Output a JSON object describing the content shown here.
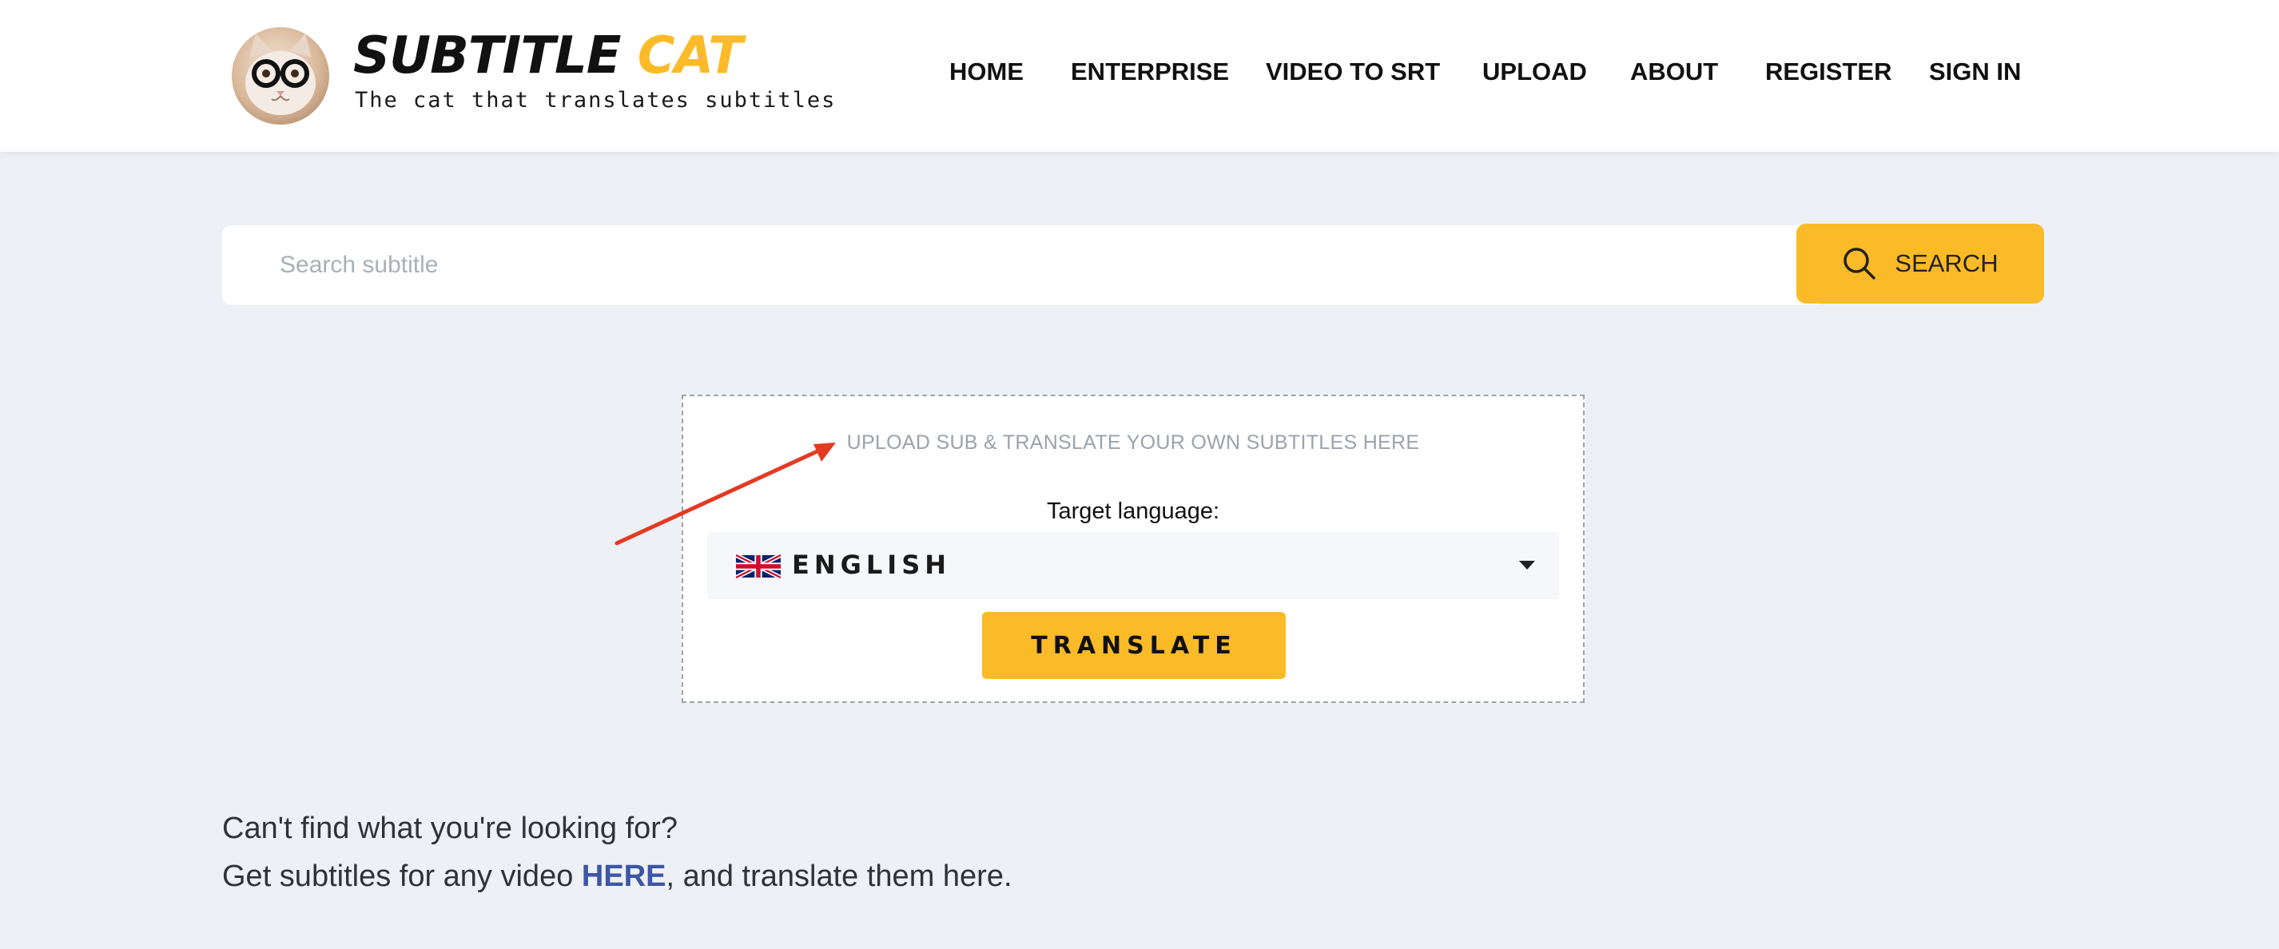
{
  "header": {
    "logo_title_part1": "SUBTITLE",
    "logo_title_part2": "CAT",
    "tagline": "The cat that translates subtitles",
    "nav": [
      {
        "label": "HOME"
      },
      {
        "label": "ENTERPRISE"
      },
      {
        "label": "VIDEO TO SRT"
      },
      {
        "label": "UPLOAD"
      },
      {
        "label": "ABOUT"
      },
      {
        "label": "REGISTER"
      },
      {
        "label": "SIGN IN"
      }
    ]
  },
  "search": {
    "placeholder": "Search subtitle",
    "value": "",
    "button_label": "SEARCH",
    "button_icon": "search-icon"
  },
  "upload_panel": {
    "title": "UPLOAD SUB & TRANSLATE YOUR OWN SUBTITLES HERE",
    "target_label": "Target language:",
    "selected_language": "ENGLISH",
    "flag_icon": "uk-flag-icon",
    "translate_label": "TRANSLATE"
  },
  "footer_help": {
    "line1": "Can't find what you're looking for?",
    "line2_before": "Get subtitles for any video ",
    "line2_link": "HERE",
    "line2_after": ", and translate them here."
  },
  "colors": {
    "accent": "#fbba27",
    "background": "#edf1f5",
    "link": "#3c55a5",
    "annotation_arrow": "#e53a22"
  }
}
